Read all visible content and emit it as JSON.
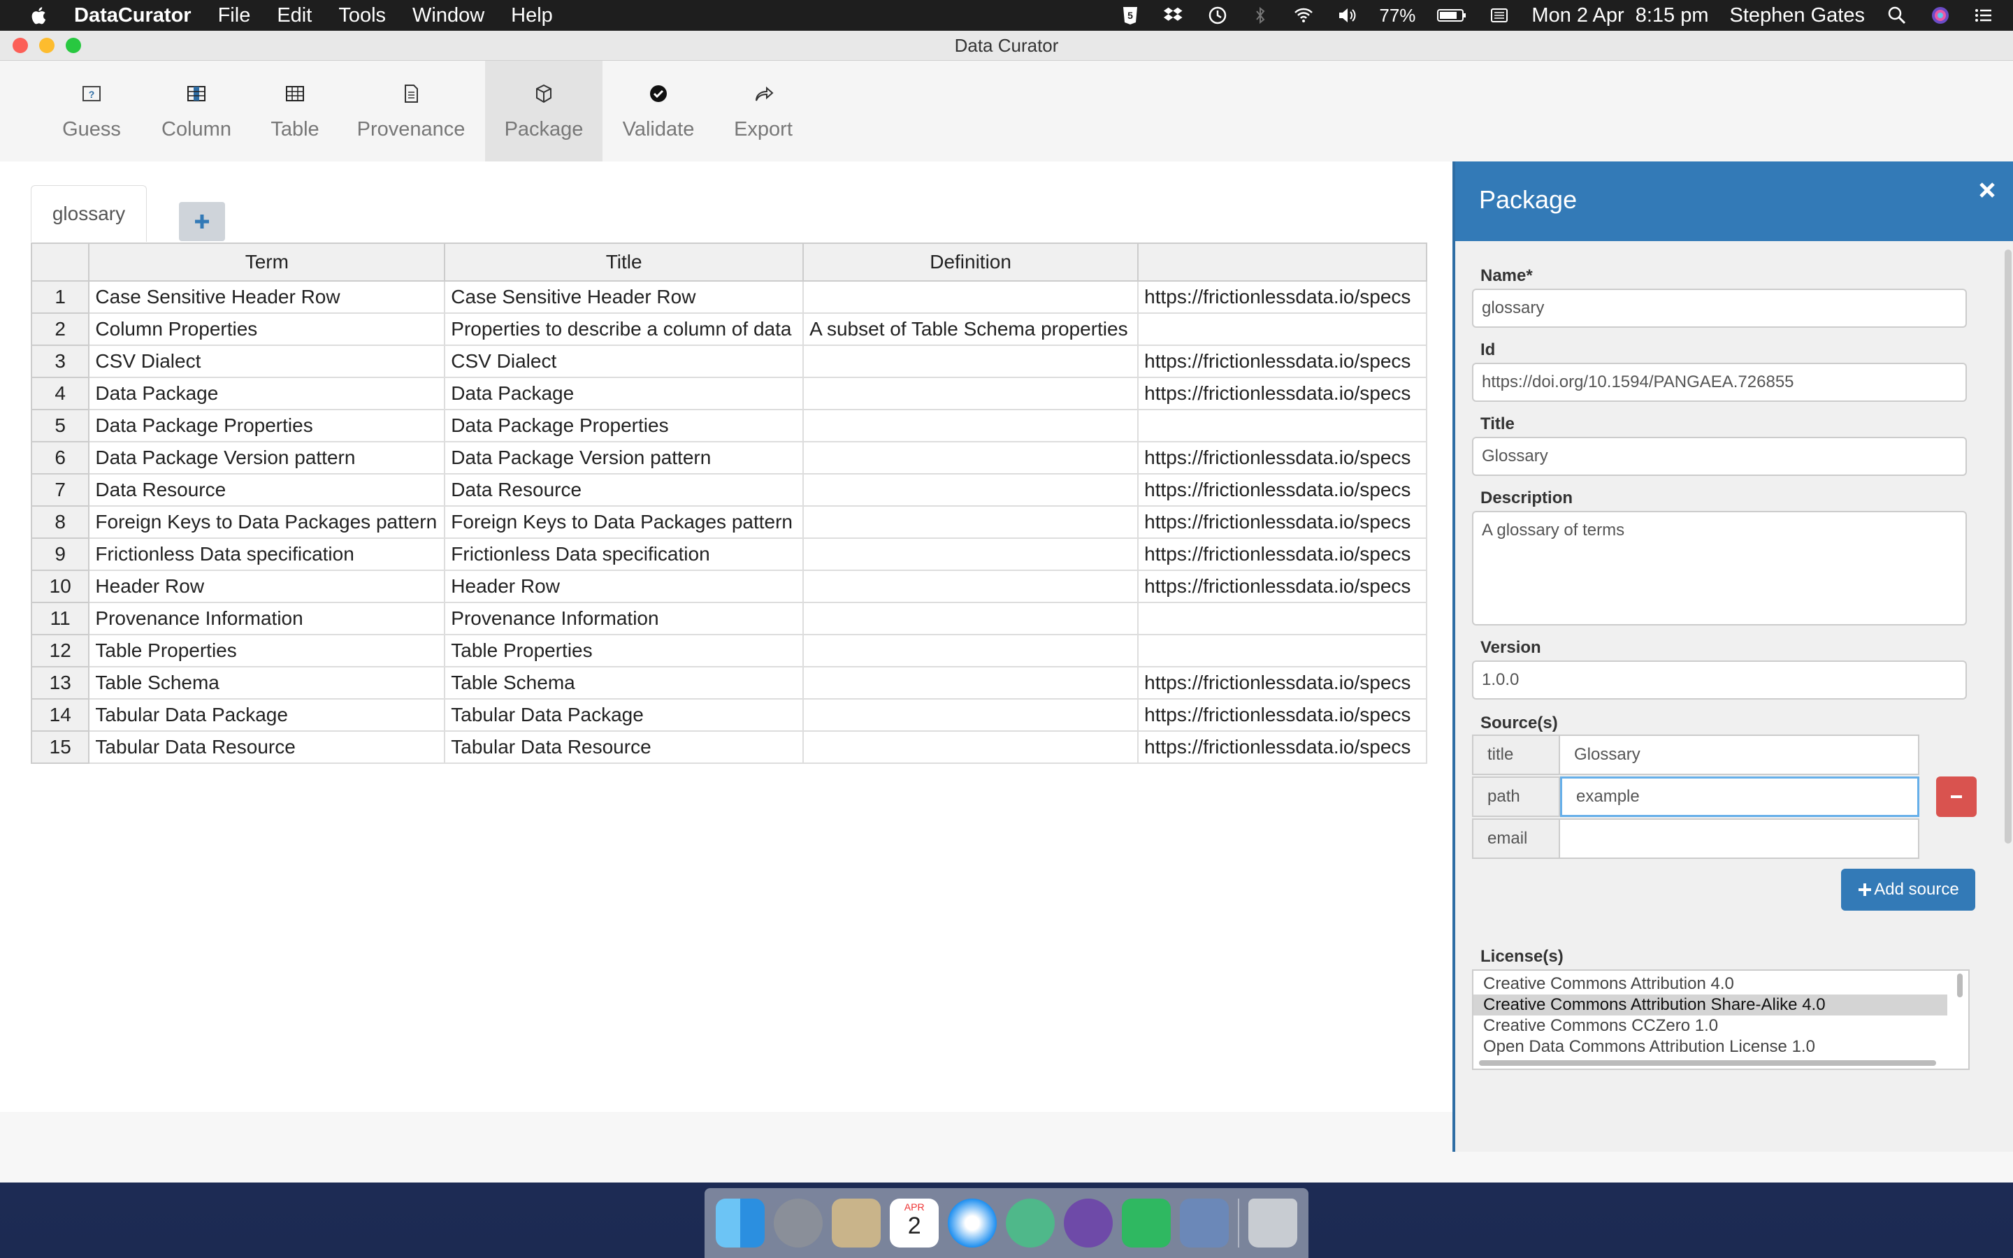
{
  "menubar": {
    "app_name": "DataCurator",
    "menus": [
      "File",
      "Edit",
      "Tools",
      "Window",
      "Help"
    ],
    "battery": "77%",
    "datetime": "Mon 2 Apr  8:15 pm",
    "user": "Stephen Gates"
  },
  "window": {
    "title": "Data Curator"
  },
  "toolbar": {
    "items": [
      {
        "label": "Guess",
        "icon": "guess-icon"
      },
      {
        "label": "Column",
        "icon": "column-icon"
      },
      {
        "label": "Table",
        "icon": "table-icon"
      },
      {
        "label": "Provenance",
        "icon": "provenance-icon"
      },
      {
        "label": "Package",
        "icon": "package-icon",
        "active": true
      },
      {
        "label": "Validate",
        "icon": "check-icon"
      },
      {
        "label": "Export",
        "icon": "export-icon"
      }
    ]
  },
  "tabs": {
    "active": "glossary",
    "add_icon": "plus-icon"
  },
  "grid": {
    "headers": [
      "Term",
      "Title",
      "Definition",
      ""
    ],
    "rows": [
      {
        "n": "1",
        "term": "Case Sensitive Header Row",
        "title": "Case Sensitive Header Row",
        "definition": "",
        "ref": "https://frictionlessdata.io/specs"
      },
      {
        "n": "2",
        "term": "Column Properties",
        "title": "Properties to describe a column of data",
        "definition": "A subset of Table Schema properties",
        "ref": ""
      },
      {
        "n": "3",
        "term": "CSV Dialect",
        "title": "CSV Dialect",
        "definition": "",
        "ref": "https://frictionlessdata.io/specs"
      },
      {
        "n": "4",
        "term": "Data Package",
        "title": "Data Package",
        "definition": "",
        "ref": "https://frictionlessdata.io/specs"
      },
      {
        "n": "5",
        "term": "Data Package Properties",
        "title": "Data Package Properties",
        "definition": "",
        "ref": ""
      },
      {
        "n": "6",
        "term": "Data Package Version pattern",
        "title": "Data Package Version pattern",
        "definition": "",
        "ref": "https://frictionlessdata.io/specs"
      },
      {
        "n": "7",
        "term": "Data Resource",
        "title": "Data Resource",
        "definition": "",
        "ref": "https://frictionlessdata.io/specs"
      },
      {
        "n": "8",
        "term": "Foreign Keys to Data Packages pattern",
        "title": "Foreign Keys to Data Packages pattern",
        "definition": "",
        "ref": "https://frictionlessdata.io/specs"
      },
      {
        "n": "9",
        "term": "Frictionless Data specification",
        "title": "Frictionless Data specification",
        "definition": "",
        "ref": "https://frictionlessdata.io/specs"
      },
      {
        "n": "10",
        "term": "Header Row",
        "title": "Header Row",
        "definition": "",
        "ref": "https://frictionlessdata.io/specs"
      },
      {
        "n": "11",
        "term": "Provenance Information",
        "title": "Provenance Information",
        "definition": "",
        "ref": ""
      },
      {
        "n": "12",
        "term": "Table Properties",
        "title": "Table Properties",
        "definition": "",
        "ref": ""
      },
      {
        "n": "13",
        "term": "Table Schema",
        "title": "Table Schema",
        "definition": "",
        "ref": "https://frictionlessdata.io/specs"
      },
      {
        "n": "14",
        "term": "Tabular Data Package",
        "title": "Tabular Data Package",
        "definition": "",
        "ref": "https://frictionlessdata.io/specs"
      },
      {
        "n": "15",
        "term": "Tabular Data Resource",
        "title": "Tabular Data Resource",
        "definition": "",
        "ref": "https://frictionlessdata.io/specs"
      }
    ]
  },
  "panel": {
    "title": "Package",
    "name_label": "Name*",
    "name_value": "glossary",
    "id_label": "Id",
    "id_value": "https://doi.org/10.1594/PANGAEA.726855",
    "title_label": "Title",
    "title_value": "Glossary",
    "description_label": "Description",
    "description_value": "A glossary of terms",
    "version_label": "Version",
    "version_value": "1.0.0",
    "sources_label": "Source(s)",
    "source": {
      "title_key": "title",
      "title_value": "Glossary",
      "path_key": "path",
      "path_value": "example",
      "email_key": "email",
      "email_value": ""
    },
    "add_source_label": "Add source",
    "licenses_label": "License(s)",
    "licenses": [
      "Creative Commons Attribution 4.0",
      "Creative Commons Attribution Share-Alike 4.0",
      "Creative Commons CCZero 1.0",
      "Open Data Commons Attribution License 1.0"
    ],
    "selected_license": "Creative Commons Attribution Share-Alike 4.0"
  },
  "colors": {
    "panel_header": "#337ab7",
    "remove_button": "#d9534f",
    "add_source_button": "#337ab7"
  },
  "dock": {
    "apps": [
      "finder-icon",
      "launchpad-icon",
      "mail-icon",
      "calendar-icon",
      "safari-icon",
      "atom-icon",
      "github-icon",
      "cube-icon",
      "preview-icon",
      "trash-icon"
    ],
    "calendar_month": "APR",
    "calendar_day": "2"
  }
}
